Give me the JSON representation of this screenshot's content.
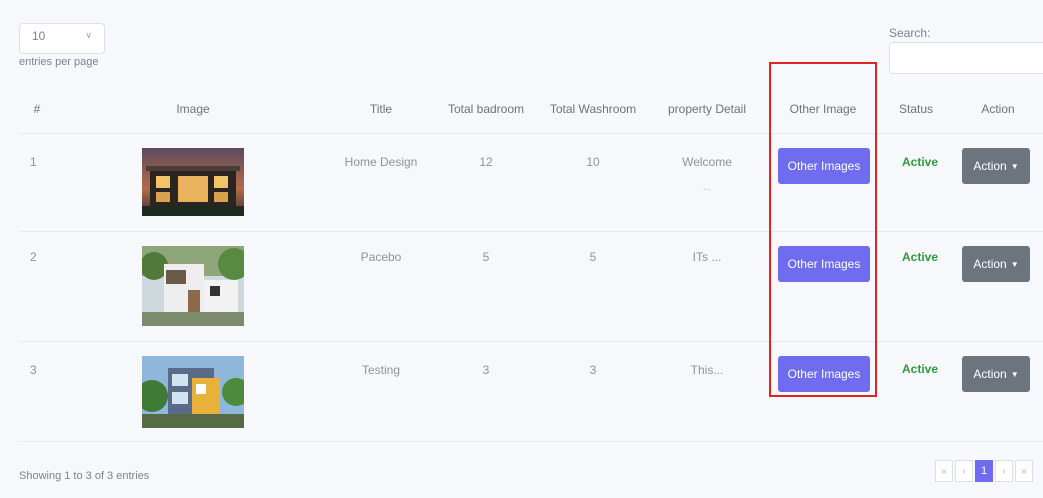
{
  "length_menu": {
    "value": "10",
    "label": "entries per page"
  },
  "search": {
    "label": "Search:",
    "placeholder": ""
  },
  "table": {
    "headers": [
      "#",
      "Image",
      "Title",
      "Total badroom",
      "Total Washroom",
      "property Detail",
      "Other Image",
      "Status",
      "Action"
    ],
    "rows": [
      {
        "num": "1",
        "image": "house-1",
        "title": "Home Design",
        "bedrooms": "12",
        "washrooms": "10",
        "detail": "Welcome",
        "detail_more": "...",
        "other_btn": "Other Images",
        "status": "Active",
        "action_btn": "Action"
      },
      {
        "num": "2",
        "image": "house-2",
        "title": "Pacebo",
        "bedrooms": "5",
        "washrooms": "5",
        "detail": "ITs ...",
        "detail_more": "",
        "other_btn": "Other Images",
        "status": "Active",
        "action_btn": "Action"
      },
      {
        "num": "3",
        "image": "house-3",
        "title": "Testing",
        "bedrooms": "3",
        "washrooms": "3",
        "detail": "This...",
        "detail_more": "",
        "other_btn": "Other Images",
        "status": "Active",
        "action_btn": "Action"
      }
    ]
  },
  "info": "Showing 1 to 3 of 3 entries",
  "pagination": {
    "first": "«",
    "prev": "‹",
    "current": "1",
    "next": "›",
    "last": "»"
  },
  "colors": {
    "primary": "#6f6cf0",
    "status_active": "#2f9a3e",
    "action_button": "#6c757d",
    "highlight": "#e02424"
  },
  "icons": {
    "select_arrow": "chevron-down-icon",
    "action_caret": "caret-down-icon"
  }
}
